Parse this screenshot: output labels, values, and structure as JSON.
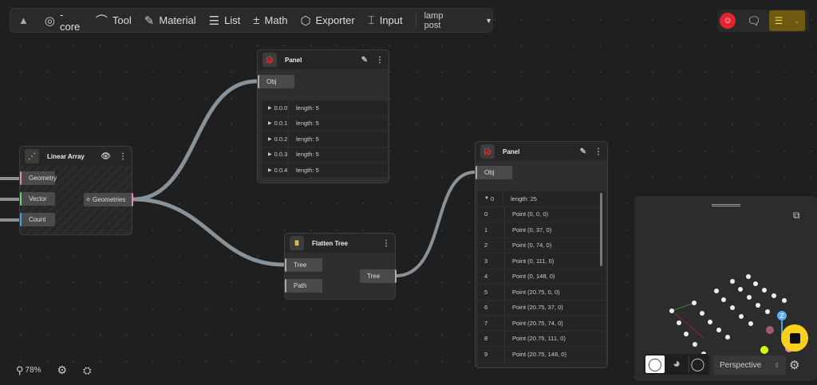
{
  "toolbar": {
    "items": [
      {
        "label": "-core",
        "icon": "target-icon"
      },
      {
        "label": "Tool",
        "icon": "bezier-icon"
      },
      {
        "label": "Material",
        "icon": "brush-icon"
      },
      {
        "label": "List",
        "icon": "list-icon"
      },
      {
        "label": "Math",
        "icon": "math-icon"
      },
      {
        "label": "Exporter",
        "icon": "cube-export-icon"
      },
      {
        "label": "Input",
        "icon": "input-icon"
      }
    ],
    "project": "lamp post"
  },
  "linear_array": {
    "title": "Linear Array",
    "inputs": [
      "Geometry",
      "Vector",
      "Count"
    ],
    "output": "Geometries",
    "colors": [
      "#e889b0",
      "#6fd36f",
      "#3fa3e8"
    ]
  },
  "panel1": {
    "title": "Panel",
    "input": "Obj",
    "rows": [
      {
        "k": "0.0.0",
        "v": "length: 5"
      },
      {
        "k": "0.0.1",
        "v": "length: 5"
      },
      {
        "k": "0.0.2",
        "v": "length: 5"
      },
      {
        "k": "0.0.3",
        "v": "length: 5"
      },
      {
        "k": "0.0.4",
        "v": "length: 5"
      }
    ]
  },
  "flatten": {
    "title": "Flatten Tree",
    "inputs": [
      "Tree",
      "Path"
    ],
    "output": "Tree"
  },
  "panel2": {
    "title": "Panel",
    "input": "Obj",
    "header": {
      "k": "0",
      "v": "length: 25"
    },
    "rows": [
      {
        "k": "0",
        "v": "Point (0, 0, 0)"
      },
      {
        "k": "1",
        "v": "Point (0, 37, 0)"
      },
      {
        "k": "2",
        "v": "Point (0, 74, 0)"
      },
      {
        "k": "3",
        "v": "Point (0, 111, 0)"
      },
      {
        "k": "4",
        "v": "Point (0, 148, 0)"
      },
      {
        "k": "5",
        "v": "Point (20.75, 0, 0)"
      },
      {
        "k": "6",
        "v": "Point (20.75, 37, 0)"
      },
      {
        "k": "7",
        "v": "Point (20.75, 74, 0)"
      },
      {
        "k": "8",
        "v": "Point (20.75, 111, 0)"
      },
      {
        "k": "9",
        "v": "Point (20.75, 148, 0)"
      }
    ]
  },
  "viewport": {
    "camera": "Perspective",
    "axis_label": "Z"
  },
  "zoom": "78%",
  "colors": {
    "accent": "#f4d34a",
    "avatar": "#e52331"
  }
}
